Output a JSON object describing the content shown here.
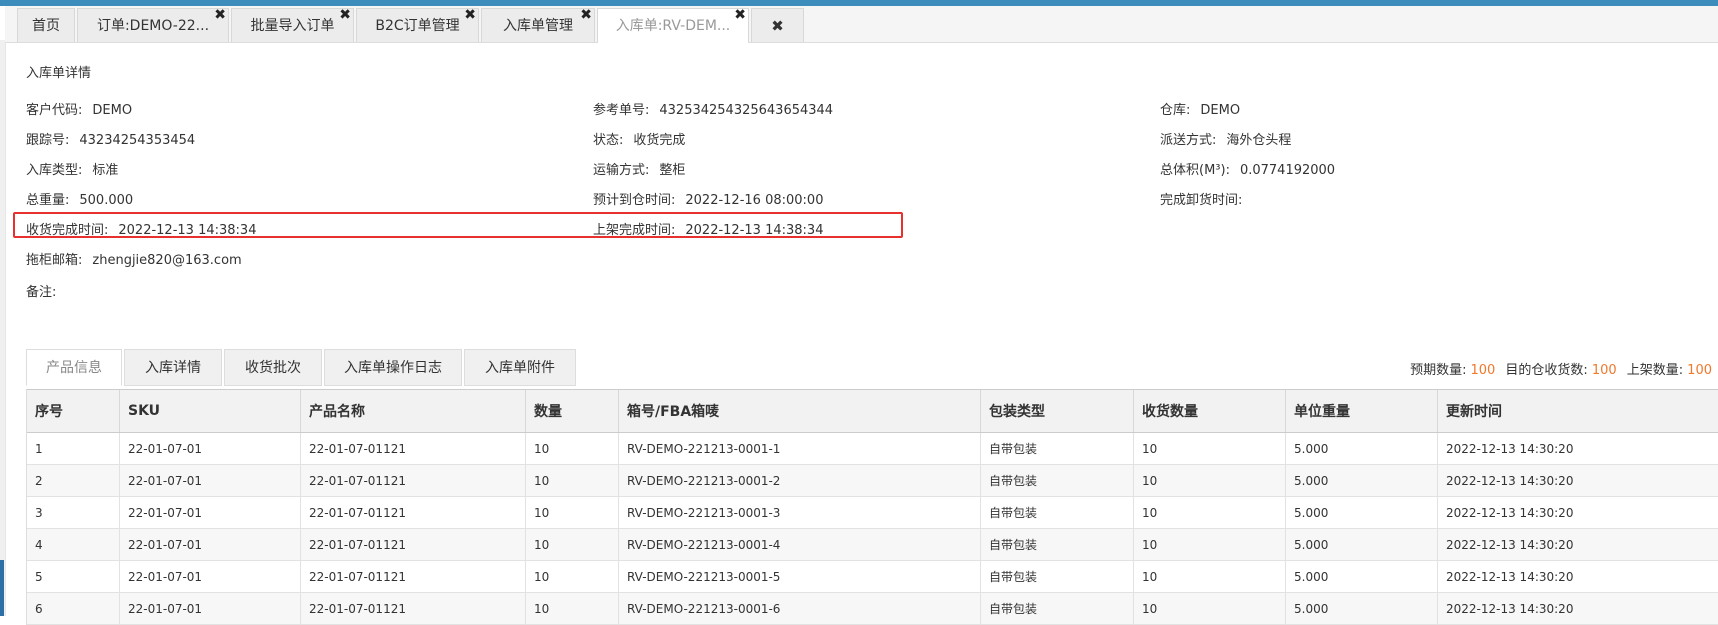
{
  "tabs": [
    {
      "label": "首页",
      "closable": false
    },
    {
      "label": "订单:DEMO-22...",
      "closable": true
    },
    {
      "label": "批量导入订单",
      "closable": true
    },
    {
      "label": "B2C订单管理",
      "closable": true
    },
    {
      "label": "入库单管理",
      "closable": true
    },
    {
      "label": "入库单:RV-DEM...",
      "closable": true,
      "active": true
    }
  ],
  "close_all_glyph": "✖",
  "close_glyph": "✖",
  "section_title": "入库单详情",
  "fields": {
    "customer_code": {
      "label": "客户代码:",
      "value": "DEMO"
    },
    "reference_no": {
      "label": "参考单号:",
      "value": "432534254325643654344"
    },
    "warehouse": {
      "label": "仓库:",
      "value": "DEMO"
    },
    "tracking_no": {
      "label": "跟踪号:",
      "value": "43234254353454"
    },
    "status": {
      "label": "状态:",
      "value": "收货完成"
    },
    "delivery_method": {
      "label": "派送方式:",
      "value": "海外仓头程"
    },
    "inbound_type": {
      "label": "入库类型:",
      "value": "标准"
    },
    "transport_mode": {
      "label": "运输方式:",
      "value": "整柜"
    },
    "total_volume": {
      "label": "总体积(M³):",
      "value": "0.0774192000"
    },
    "total_weight": {
      "label": "总重量:",
      "value": "500.000"
    },
    "eta": {
      "label": "预计到仓时间:",
      "value": "2022-12-16 08:00:00"
    },
    "unload_time": {
      "label": "完成卸货时间:",
      "value": ""
    },
    "receive_time": {
      "label": "收货完成时间:",
      "value": "2022-12-13 14:38:34"
    },
    "shelve_time": {
      "label": "上架完成时间:",
      "value": "2022-12-13 14:38:34"
    },
    "email": {
      "label": "拖柜邮箱:",
      "value": "zhengjie820@163.com"
    },
    "remark": {
      "label": "备注:",
      "value": ""
    }
  },
  "product_tabs": [
    "产品信息",
    "入库详情",
    "收货批次",
    "入库单操作日志",
    "入库单附件"
  ],
  "counts": {
    "expected_label": "预期数量:",
    "expected": "100",
    "received_label": "目的仓收货数:",
    "received": "100",
    "shelved_label": "上架数量:",
    "shelved": "100"
  },
  "table": {
    "columns": [
      "序号",
      "SKU",
      "产品名称",
      "数量",
      "箱号/FBA箱唛",
      "包装类型",
      "收货数量",
      "单位重量",
      "更新时间"
    ],
    "rows": [
      [
        "1",
        "22-01-07-01",
        "22-01-07-01121",
        "10",
        "RV-DEMO-221213-0001-1",
        "自带包装",
        "10",
        "5.000",
        "2022-12-13 14:30:20"
      ],
      [
        "2",
        "22-01-07-01",
        "22-01-07-01121",
        "10",
        "RV-DEMO-221213-0001-2",
        "自带包装",
        "10",
        "5.000",
        "2022-12-13 14:30:20"
      ],
      [
        "3",
        "22-01-07-01",
        "22-01-07-01121",
        "10",
        "RV-DEMO-221213-0001-3",
        "自带包装",
        "10",
        "5.000",
        "2022-12-13 14:30:20"
      ],
      [
        "4",
        "22-01-07-01",
        "22-01-07-01121",
        "10",
        "RV-DEMO-221213-0001-4",
        "自带包装",
        "10",
        "5.000",
        "2022-12-13 14:30:20"
      ],
      [
        "5",
        "22-01-07-01",
        "22-01-07-01121",
        "10",
        "RV-DEMO-221213-0001-5",
        "自带包装",
        "10",
        "5.000",
        "2022-12-13 14:30:20"
      ],
      [
        "6",
        "22-01-07-01",
        "22-01-07-01121",
        "10",
        "RV-DEMO-221213-0001-6",
        "自带包装",
        "10",
        "5.000",
        "2022-12-13 14:30:20"
      ]
    ]
  },
  "colors": {
    "accent": "#3c8dbc",
    "count_number": "#f0782c",
    "highlight_border": "#e8312f"
  }
}
